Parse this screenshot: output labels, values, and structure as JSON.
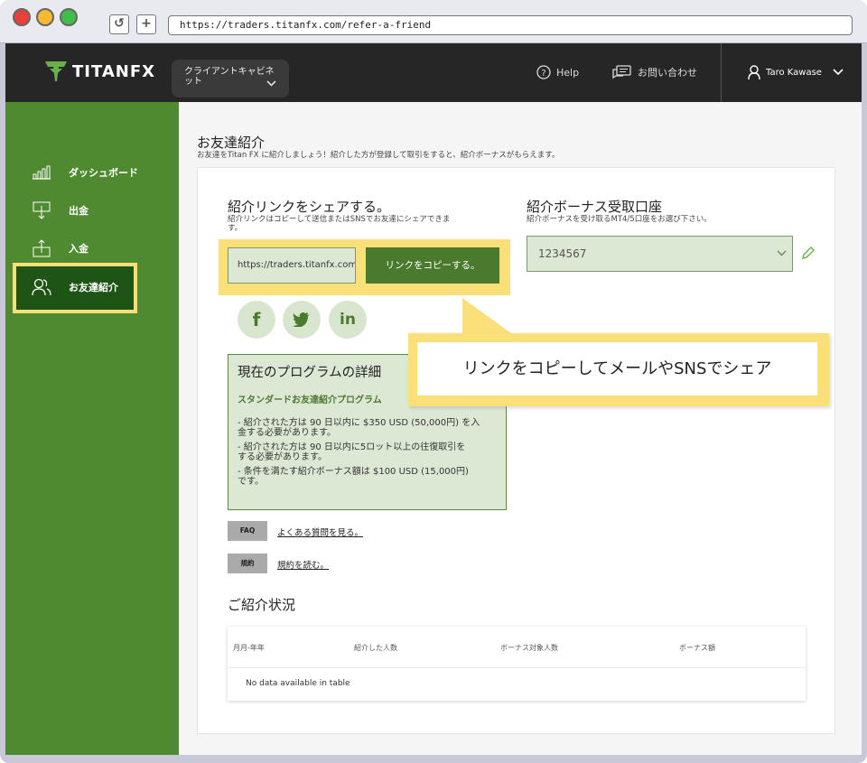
{
  "browser": {
    "url": "https://traders.titanfx.com/refer-a-friend",
    "reload_glyph": "↺",
    "newtab_glyph": "+"
  },
  "topbar": {
    "brand": "TITANFX",
    "client_cabinet": {
      "line1": "クライアントキャビネ",
      "line2": "ット"
    },
    "help": "Help",
    "contact": "お問い合わせ",
    "user": "Taro Kawase"
  },
  "sidebar": {
    "items": [
      {
        "label": "ダッシュボード",
        "icon": "bar-chart-icon"
      },
      {
        "label": "出金",
        "icon": "withdraw-icon"
      },
      {
        "label": "入金",
        "icon": "deposit-icon"
      },
      {
        "label": "お友達紹介",
        "icon": "users-icon"
      }
    ]
  },
  "main": {
    "title": "お友達紹介",
    "subtitle": "お友達をTitan FX に紹介しましょう！紹介した方が登録して取引をすると、紹介ボーナスがもらえます。",
    "share": {
      "heading": "紹介リンクをシェアする。",
      "desc_line1": "紹介リンクはコピーして送信またはSNSでお友達にシェアできま",
      "desc_line2": "す。",
      "link_value": "https://traders.titanfx.com/",
      "copy_button": "リンクをコピーする。",
      "social": [
        "f",
        "t",
        "in"
      ]
    },
    "bonus_account": {
      "heading": "紹介ボーナス受取口座",
      "desc": "紹介ボーナスを受け取るMT4/5口座をお選び下さい。",
      "selected": "1234567"
    },
    "program": {
      "title": "現在のプログラムの詳細",
      "name": "スタンダードお友達紹介プログラム",
      "lines": [
        {
          "l1": "- 紹介された方は 90 日以内に $350 USD (50,000円) を入",
          "l2": "金する必要があります。"
        },
        {
          "l1": "- 紹介された方は 90 日以内に5ロット以上の往復取引を",
          "l2": "する必要があります。"
        },
        {
          "l1": "- 条件を満たす紹介ボーナス額は $100 USD (15,000円)",
          "l2": "です。"
        }
      ]
    },
    "faq": {
      "tag": "FAQ",
      "link": "よくある質問を見る。"
    },
    "terms": {
      "tag": "規約",
      "link": "規約を読む。"
    },
    "status": {
      "heading": "ご紹介状況",
      "columns": [
        "月月-年年",
        "紹介した人数",
        "ボーナス対象人数",
        "ボーナス額"
      ],
      "empty": "No data available in table"
    }
  },
  "callout": {
    "text": "リンクをコピーしてメールやSNSでシェア"
  },
  "colors": {
    "sidebar": "#4f8a31",
    "accent": "#4a7a2e",
    "highlight": "#fbe07a",
    "topbar": "#262626"
  }
}
